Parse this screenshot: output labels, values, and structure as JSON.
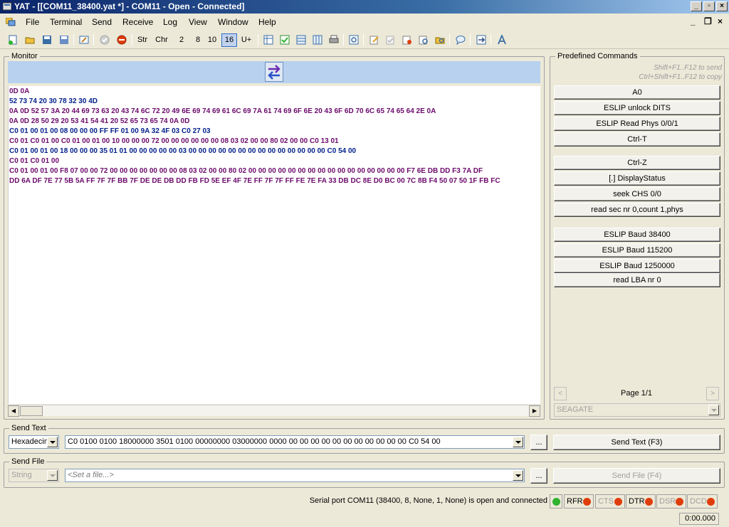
{
  "title": "YAT - [[COM11_38400.yat *] - COM11 - Open - Connected]",
  "menu": [
    "File",
    "Terminal",
    "Send",
    "Receive",
    "Log",
    "View",
    "Window",
    "Help"
  ],
  "toolbar": {
    "radix": [
      "Str",
      "Chr",
      "2",
      "8",
      "10",
      "16",
      "U+"
    ],
    "active_radix": "16"
  },
  "monitor": {
    "label": "Monitor",
    "lines": [
      {
        "text": "0D 0A",
        "dir": "rx"
      },
      {
        "text": "52 73 74 20 30 78 32 30 4D",
        "dir": "tx"
      },
      {
        "text": "0A 0D 52 57 3A 20 44 69 73 63 20 43 74 6C 72 20 49 6E 69 74 69 61 6C 69 7A 61 74 69 6F 6E 20 43 6F 6D 70 6C 65 74 65 64 2E 0A",
        "dir": "rx"
      },
      {
        "text": "0A 0D 28 50 29 20 53 41 54 41 20 52 65 73 65 74 0A 0D",
        "dir": "rx"
      },
      {
        "text": "C0 01 00 01 00 08 00 00 00 FF FF 01 00 9A 32 4F 03 C0 27 03",
        "dir": "tx"
      },
      {
        "text": "C0 01 C0 01 00 C0 01 00 01 00 10 00 00 00 72 00 00 00 00 00 00 08 03 02 00 00 80 02 00 00 C0 13 01",
        "dir": "rx"
      },
      {
        "text": "C0 01 00 01 00 18 00 00 00 35 01 01 00 00 00 00 00 03 00 00 00 00 00 00 00 00 00 00 00 00 00 00 C0 54 00",
        "dir": "tx"
      },
      {
        "text": "C0 01 C0 01 00",
        "dir": "rx"
      },
      {
        "text": "C0 01 00 01 00 F8 07 00 00 72 00 00 00 00 00 00 00 08 03 02 00 00 80 02 00 00 00 00 00 00 00 00 00 00 00 00 00 00 00 00 F7 6E DB DD F3 7A DF",
        "dir": "rx"
      },
      {
        "text": "DD 6A DF 7E 77 5B 5A FF 7F 7F BB 7F DE DE DB DD FB FD 5E EF 4F 7E FF 7F 7F FF FE 7E FA 33 DB DC 8E D0 BC 00 7C 8B F4 50 07 50 1F FB FC",
        "dir": "rx"
      }
    ]
  },
  "predefined": {
    "label": "Predefined Commands",
    "hint1": "Shift+F1..F12  to send",
    "hint2": "Ctrl+Shift+F1..F12  to copy",
    "commands": [
      "A0",
      "ESLIP unlock DITS",
      "ESLIP Read Phys 0/0/1",
      "Ctrl-T",
      "Ctrl-Z",
      "[.] DisplayStatus",
      "seek CHS 0/0",
      "read sec nr 0,count 1,phys",
      "ESLIP Baud 38400",
      "ESLIP Baud 115200",
      "ESLIP Baud 1250000",
      "read LBA nr 0"
    ],
    "page": "Page 1/1",
    "set": "SEAGATE"
  },
  "send_text": {
    "label": "Send Text",
    "mode": "Hexadecimal",
    "value": "C0 0100 0100 18000000 3501 0100 00000000 03000000 0000 00 00 00 00 00 00 00 00 00 00 00 C0 54 00",
    "browse": "...",
    "button": "Send Text (F3)"
  },
  "send_file": {
    "label": "Send File",
    "mode": "String",
    "placeholder": "<Set a file...>",
    "browse": "...",
    "button": "Send File (F4)"
  },
  "status": {
    "text": "Serial port COM11 (38400, 8, None, 1, None) is open and connected",
    "signals": [
      {
        "name": "RFR",
        "active": true
      },
      {
        "name": "CTS",
        "active": false
      },
      {
        "name": "DTR",
        "active": true
      },
      {
        "name": "DSR",
        "active": false
      },
      {
        "name": "DCD",
        "active": false
      }
    ],
    "timer": "0:00.000"
  },
  "colors": {
    "rx": "#6b0a6b",
    "tx": "#001f8a",
    "led_on": "#2fb32f",
    "led_red": "#e03d0c"
  }
}
